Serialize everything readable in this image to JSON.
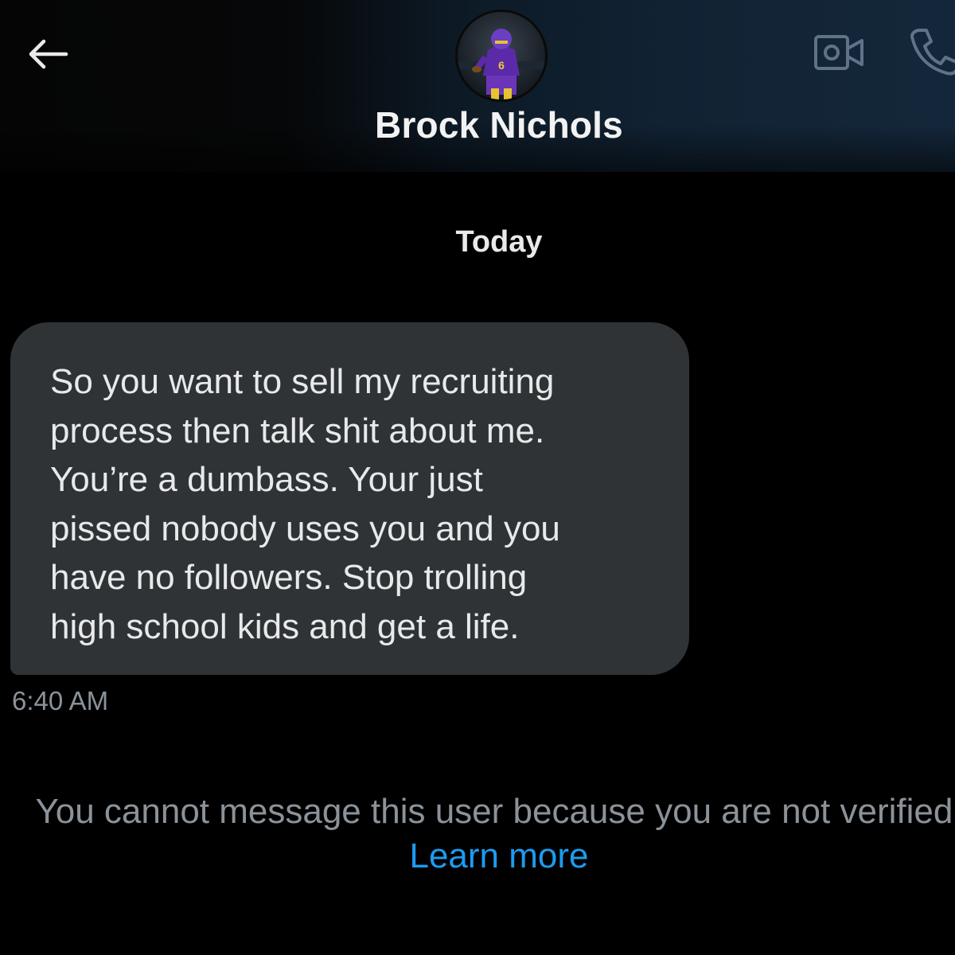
{
  "header": {
    "contact_name": "Brock Nichols",
    "back_icon": "arrow-left-icon",
    "video_icon": "video-camera-icon",
    "phone_icon": "phone-icon",
    "avatar_jersey_number": "6"
  },
  "conversation": {
    "date_label": "Today",
    "messages": [
      {
        "text": "So you want to sell my recruiting\nprocess then talk shit about me.\nYou’re a dumbass.  Your just\npissed nobody uses you and you\nhave no followers.  Stop trolling\nhigh school kids and get a life.",
        "time": "6:40 AM",
        "direction": "incoming"
      }
    ]
  },
  "footer": {
    "notice_text": "You cannot message this user because you are not verified.",
    "learn_more_label": "Learn more"
  },
  "colors": {
    "background": "#000000",
    "bubble": "#2f3336",
    "text": "#e7e9ea",
    "muted": "#8b9299",
    "link": "#1d9bf0",
    "header_tint": "#14273a"
  }
}
